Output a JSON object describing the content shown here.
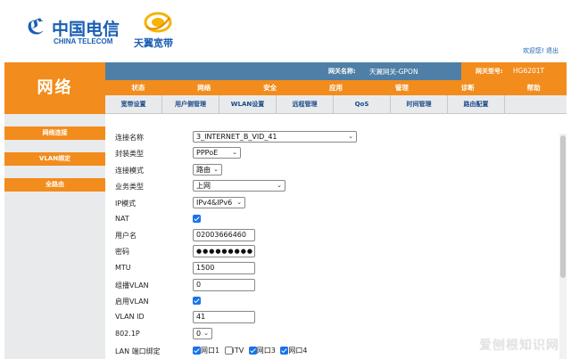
{
  "header": {
    "telecom_cn": "中国电信",
    "telecom_en": "CHINA TELECOM",
    "tianyi": "天翼宽带",
    "welcome": "欢迎您! 退出"
  },
  "section_title": "网络",
  "infobar": {
    "gateway_label": "网关名称:",
    "gateway_value": "天翼网关-GPON",
    "model_label": "网关型号:",
    "model_value": "HG6201T"
  },
  "mainnav": [
    "状态",
    "网络",
    "安全",
    "应用",
    "管理",
    "诊断",
    "帮助"
  ],
  "subnav": [
    "宽带设置",
    "用户侧管理",
    "WLAN设置",
    "远程管理",
    "QoS",
    "时间管理",
    "路由配置"
  ],
  "sidebar": [
    "网络连接",
    "VLAN绑定",
    "全路由"
  ],
  "form": {
    "connection_name": {
      "label": "连接名称",
      "value": "3_INTERNET_B_VID_41"
    },
    "encapsulation": {
      "label": "封装类型",
      "value": "PPPoE"
    },
    "connection_mode": {
      "label": "连接模式",
      "value": "路由"
    },
    "service_type": {
      "label": "业务类型",
      "value": "上网"
    },
    "ip_mode": {
      "label": "IP模式",
      "value": "IPv4&IPv6"
    },
    "nat": {
      "label": "NAT",
      "checked": true
    },
    "username": {
      "label": "用户名",
      "value": "02003666460"
    },
    "password": {
      "label": "密码",
      "value": "●●●●●●●●●"
    },
    "mtu": {
      "label": "MTU",
      "value": "1500"
    },
    "multicast_vlan": {
      "label": "组播VLAN",
      "value": "0"
    },
    "enable_vlan": {
      "label": "启用VLAN",
      "checked": true
    },
    "vlan_id": {
      "label": "VLAN ID",
      "value": "41"
    },
    "p8021": {
      "label": "802.1P",
      "value": "0"
    },
    "lan_bind": {
      "label": "LAN 端口绑定",
      "options": [
        {
          "label": "网口1",
          "checked": true
        },
        {
          "label": "iTV",
          "checked": false
        },
        {
          "label": "网口3",
          "checked": true
        },
        {
          "label": "网口4",
          "checked": true
        }
      ]
    }
  },
  "watermark": "爱刨根知识网",
  "colors": {
    "orange": "#f28c1c",
    "steel_blue": "#4f7fa6",
    "brand_blue": "#1a5fb4",
    "check_blue": "#1a73e8"
  }
}
